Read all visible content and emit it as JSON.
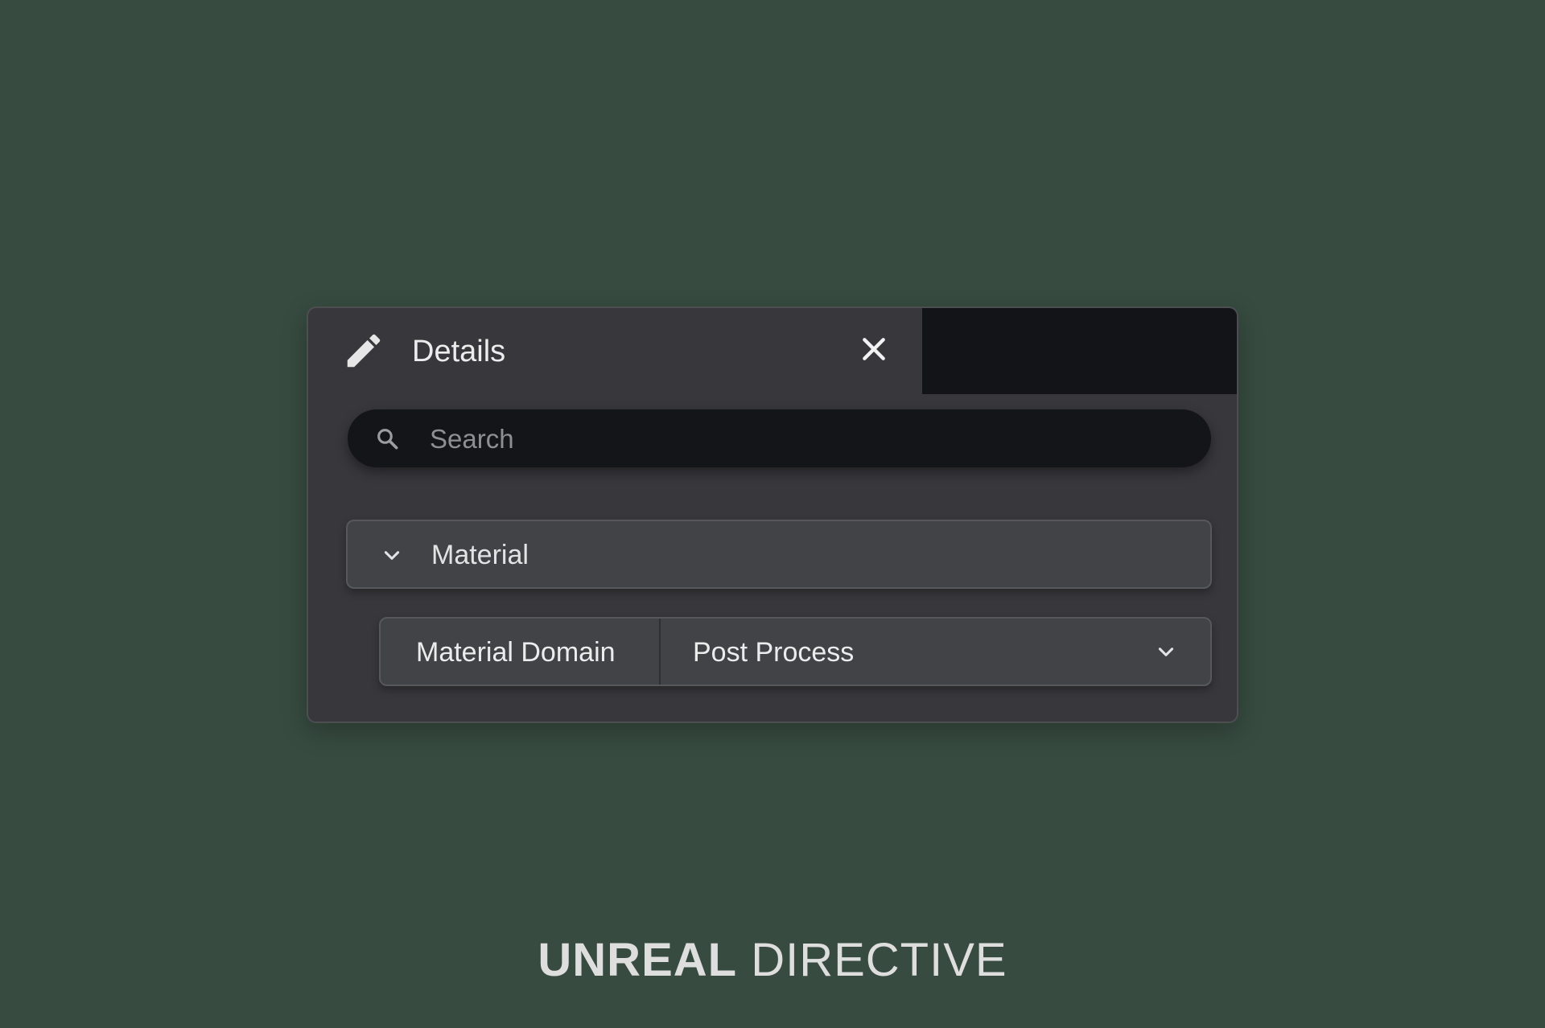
{
  "panel": {
    "tab_title": "Details",
    "search": {
      "placeholder": "Search",
      "value": ""
    },
    "section": {
      "label": "Material",
      "expanded": true
    },
    "property": {
      "name": "Material Domain",
      "value": "Post Process"
    }
  },
  "icons": {
    "tab": "pencil-icon",
    "close": "close-icon",
    "search": "search-icon",
    "section_toggle": "chevron-down-icon",
    "select_toggle": "chevron-down-icon"
  },
  "colors": {
    "background": "#374b40",
    "panel": "#38383c",
    "tab_strip": "#131417",
    "search_field": "#141519",
    "row": "#424347",
    "text": "#ececec"
  },
  "branding": {
    "bold": "UNREAL",
    "light": "DIRECTIVE"
  }
}
